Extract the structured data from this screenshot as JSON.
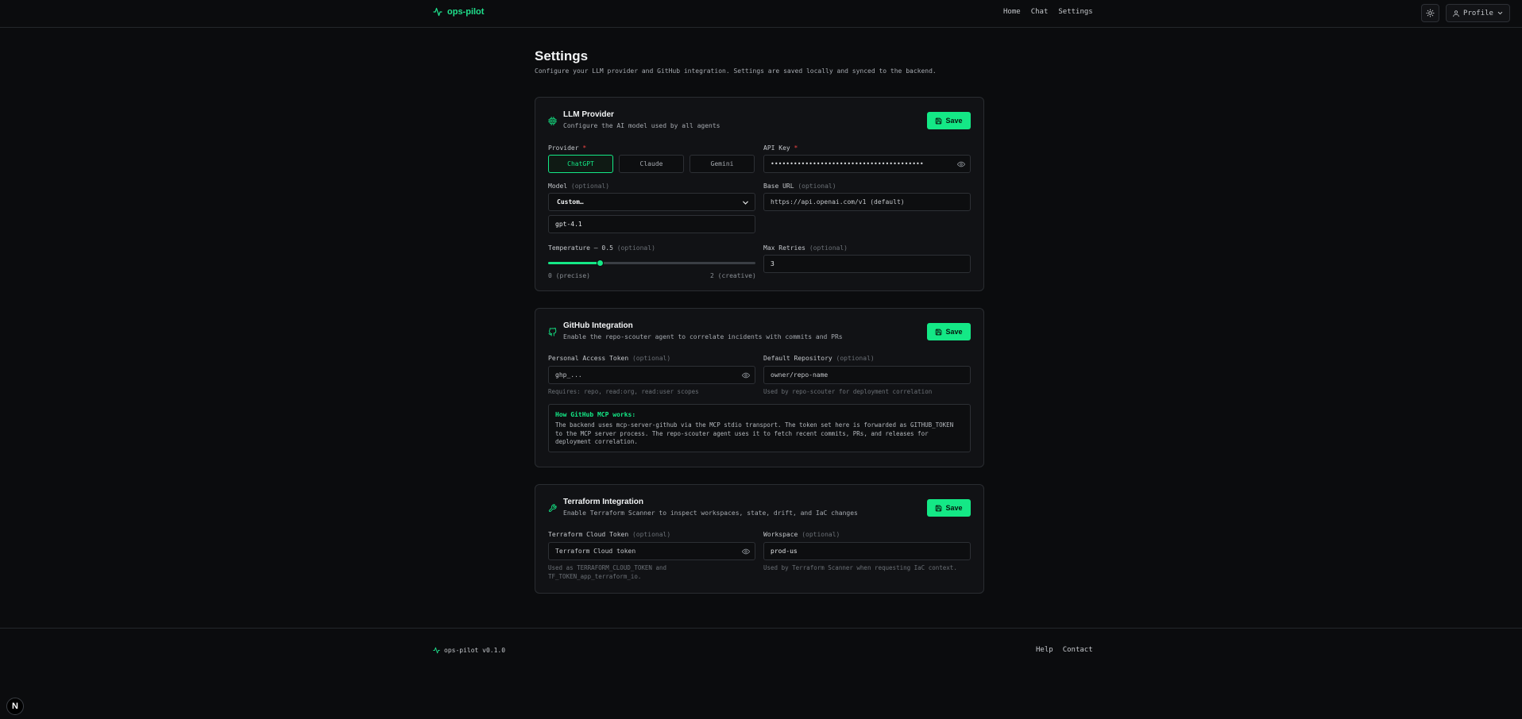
{
  "nav": {
    "brand": "ops-pilot",
    "links": [
      "Home",
      "Chat",
      "Settings"
    ],
    "profile_label": "Profile"
  },
  "page": {
    "title": "Settings",
    "subtitle": "Configure your LLM provider and GitHub integration. Settings are saved locally and synced to the backend."
  },
  "llm": {
    "title": "LLM Provider",
    "description": "Configure the AI model used by all agents",
    "save_label": "Save",
    "provider_label": "Provider",
    "required_mark": "*",
    "providers": [
      "ChatGPT",
      "Claude",
      "Gemini"
    ],
    "selected_provider": "ChatGPT",
    "api_key_label": "API Key",
    "api_key_value": "••••••••••••••••••••••••••••••••••••••••",
    "model_label": "Model",
    "optional_tag": "(optional)",
    "model_select_value": "Custom…",
    "model_custom_value": "gpt-4.1",
    "base_url_label": "Base URL",
    "base_url_placeholder": "https://api.openai.com/v1 (default)",
    "temperature_label": "Temperature — 0.5",
    "temperature_value": 0.5,
    "temperature_min": 0,
    "temperature_max": 2,
    "temperature_min_label": "0 (precise)",
    "temperature_max_label": "2 (creative)",
    "max_retries_label": "Max Retries",
    "max_retries_value": "3"
  },
  "github": {
    "title": "GitHub Integration",
    "description": "Enable the repo-scouter agent to correlate incidents with commits and PRs",
    "save_label": "Save",
    "token_label": "Personal Access Token",
    "optional_tag": "(optional)",
    "token_placeholder": "ghp_...",
    "token_hint": "Requires: repo, read:org, read:user scopes",
    "repo_label": "Default Repository",
    "repo_placeholder": "owner/repo-name",
    "repo_hint": "Used by repo-scouter for deployment correlation",
    "info_title": "How GitHub MCP works:",
    "info_body": "The backend uses mcp-server-github via the MCP stdio transport. The token set here is forwarded as GITHUB_TOKEN to the MCP server process. The repo-scouter agent uses it to fetch recent commits, PRs, and releases for deployment correlation."
  },
  "terraform": {
    "title": "Terraform Integration",
    "description": "Enable Terraform Scanner to inspect workspaces, state, drift, and IaC changes",
    "save_label": "Save",
    "token_label": "Terraform Cloud Token",
    "optional_tag": "(optional)",
    "token_placeholder": "Terraform Cloud token",
    "token_hint": "Used as TERRAFORM_CLOUD_TOKEN and TF_TOKEN_app_terraform_io.",
    "workspace_label": "Workspace",
    "workspace_value": "prod-us",
    "workspace_hint": "Used by Terraform Scanner when requesting IaC context."
  },
  "footer": {
    "brand": "ops-pilot v0.1.0",
    "links": [
      "Help",
      "Contact"
    ]
  },
  "dev_badge": "N",
  "colors": {
    "accent": "#14e886",
    "background": "#0b0c0e",
    "card": "#111215",
    "required": "#ef4444"
  }
}
